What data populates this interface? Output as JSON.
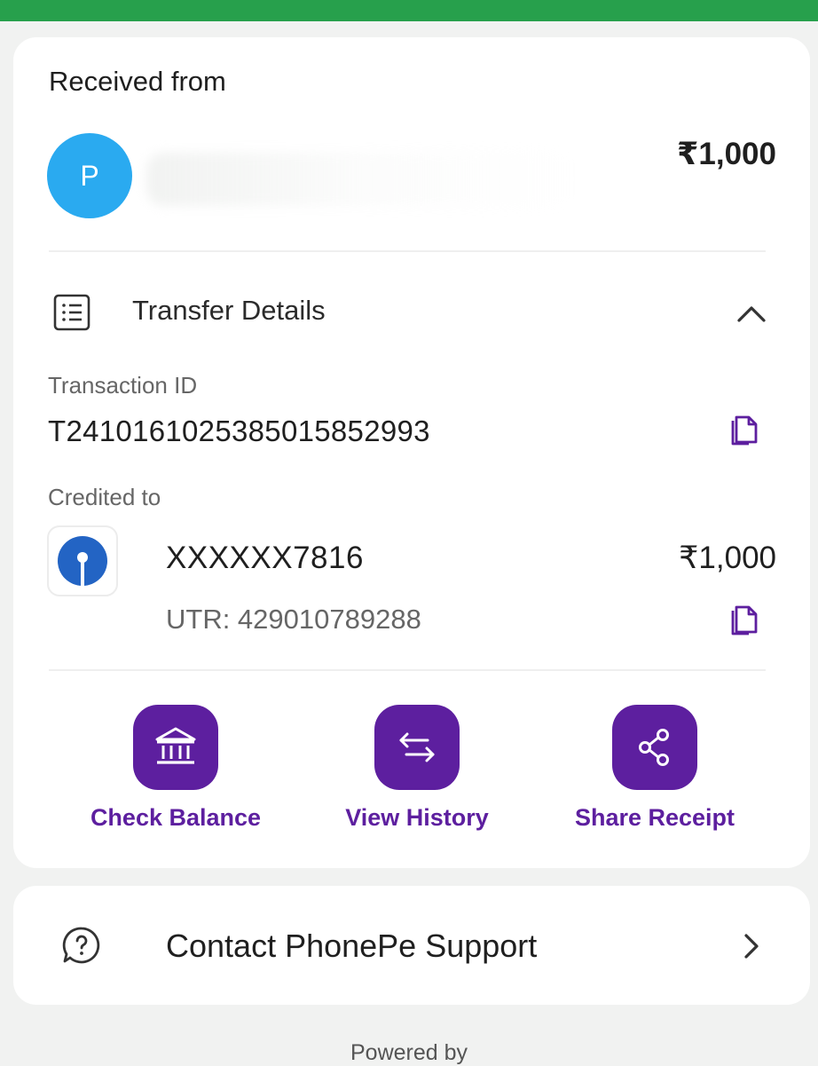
{
  "payment": {
    "section_title": "Received from",
    "sender_initial": "P",
    "amount": "₹1,000"
  },
  "transfer_details": {
    "title": "Transfer Details",
    "transaction_id_label": "Transaction ID",
    "transaction_id": "T2410161025385015852993",
    "credited_to_label": "Credited to",
    "account_number": "XXXXXX7816",
    "credited_amount": "₹1,000",
    "utr": "UTR: 429010789288"
  },
  "actions": [
    {
      "label": "Check Balance",
      "icon": "bank-icon"
    },
    {
      "label": "View History",
      "icon": "swap-arrows-icon"
    },
    {
      "label": "Share Receipt",
      "icon": "share-icon"
    }
  ],
  "support": {
    "label": "Contact PhonePe Support",
    "icon": "help-icon"
  },
  "footer": {
    "powered_by": "Powered by"
  },
  "colors": {
    "status_bar": "#27a04c",
    "brand_purple": "#5d1f9f",
    "avatar_blue": "#2aaaf0",
    "bank_blue": "#2364c4"
  }
}
